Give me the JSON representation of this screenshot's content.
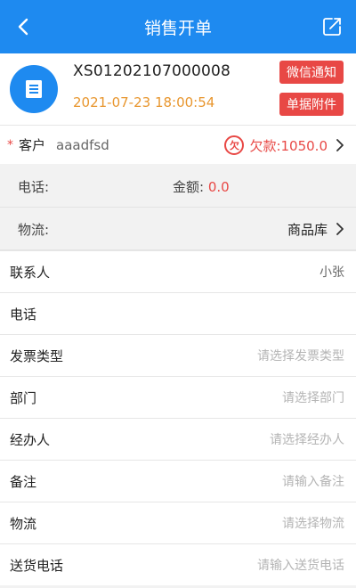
{
  "header": {
    "title": "销售开单",
    "back_icon": "chevron-left-icon",
    "edit_icon": "edit-icon"
  },
  "order": {
    "number": "XS01202107000008",
    "datetime": "2021-07-23 18:00:54",
    "wechat_btn": "微信通知",
    "attach_btn": "单据附件"
  },
  "customer": {
    "required_mark": "*",
    "label": "客户",
    "value": "aaadfsd",
    "debt_badge": "欠",
    "debt_text": "欠款:1050.0"
  },
  "info": {
    "phone_label": "电话:",
    "amount_label": "金额:",
    "amount_value": "0.0",
    "logistics_label": "物流:",
    "logistics_value": "商品库"
  },
  "fields": [
    {
      "label": "联系人",
      "value": "小张",
      "placeholder": ""
    },
    {
      "label": "电话",
      "value": "",
      "placeholder": ""
    },
    {
      "label": "发票类型",
      "value": "",
      "placeholder": "请选择发票类型"
    },
    {
      "label": "部门",
      "value": "",
      "placeholder": "请选择部门"
    },
    {
      "label": "经办人",
      "value": "",
      "placeholder": "请选择经办人"
    },
    {
      "label": "备注",
      "value": "",
      "placeholder": "请输入备注"
    },
    {
      "label": "物流",
      "value": "",
      "placeholder": "请选择物流"
    },
    {
      "label": "送货电话",
      "value": "",
      "placeholder": "请输入送货电话"
    }
  ],
  "colors": {
    "primary": "#1e8af0",
    "accent_red": "#e84845",
    "time_orange": "#e8962e"
  }
}
